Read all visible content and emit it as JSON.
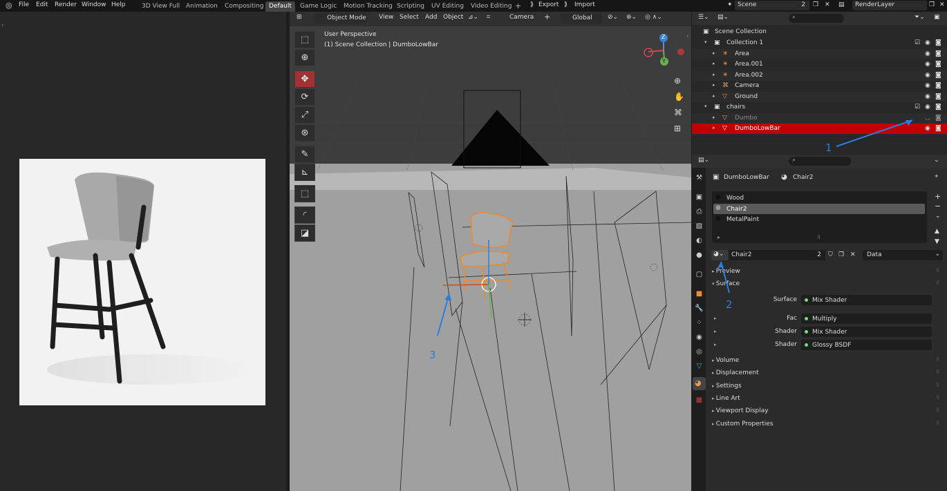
{
  "menu": [
    "File",
    "Edit",
    "Render",
    "Window",
    "Help"
  ],
  "workspaces": [
    "3D View Full",
    "Animation",
    "Compositing",
    "Default",
    "Game Logic",
    "Motion Tracking",
    "Scripting",
    "UV Editing",
    "Video Editing"
  ],
  "active_workspace": "Default",
  "add_tab": "+",
  "top_right": {
    "export": "Export",
    "import": "Import",
    "scene": "Scene",
    "scene_users": "2",
    "render_layer": "RenderLayer"
  },
  "viewport": {
    "mode": "Object Mode",
    "menus": [
      "View",
      "Select",
      "Add",
      "Object"
    ],
    "camera_label": "Camera",
    "add_plus": "+",
    "orientation": "Global",
    "overlay_title": "User Perspective",
    "overlay_subtitle": "(1) Scene Collection | DumboLowBar",
    "gizmo": {
      "z": "Z",
      "y": "Y"
    }
  },
  "outliner": {
    "root": "Scene Collection",
    "rows": [
      {
        "label": "Collection 1",
        "icon": "collection-icon",
        "level": 1
      },
      {
        "label": "Area",
        "icon": "light-icon",
        "level": 2
      },
      {
        "label": "Area.001",
        "icon": "light-icon",
        "level": 2
      },
      {
        "label": "Area.002",
        "icon": "light-icon",
        "level": 2
      },
      {
        "label": "Camera",
        "icon": "camera-icon",
        "level": 2
      },
      {
        "label": "Ground",
        "icon": "mesh-icon",
        "level": 2
      },
      {
        "label": "chairs",
        "icon": "collection-icon",
        "level": 1
      },
      {
        "label": "Dumbo",
        "icon": "mesh-icon",
        "level": 2,
        "hidden": true
      },
      {
        "label": "DumboLowBar",
        "icon": "mesh-icon",
        "level": 2,
        "selected": true
      }
    ]
  },
  "properties": {
    "object": "DumboLowBar",
    "material": "Chair2",
    "slots": [
      "Wood",
      "Chair2",
      "MetalPaint"
    ],
    "active_slot": "Chair2",
    "material_field": "Chair2",
    "material_users": "2",
    "link": "Data",
    "sections": [
      "Preview",
      "Surface"
    ],
    "surface_rows": [
      {
        "label": "Surface",
        "value": "Mix Shader"
      },
      {
        "label": "Fac",
        "value": "Multiply"
      },
      {
        "label": "Shader",
        "value": "Mix Shader"
      },
      {
        "label": "Shader",
        "value": "Glossy BSDF"
      }
    ],
    "collapsed_sections": [
      "Volume",
      "Displacement",
      "Settings",
      "Line Art",
      "Viewport Display",
      "Custom Properties"
    ]
  },
  "annotations": [
    "1",
    "2",
    "3"
  ],
  "colors": {
    "selected_row": "#c00000",
    "annotation": "#2b7de0",
    "active_tool": "#a33131"
  }
}
